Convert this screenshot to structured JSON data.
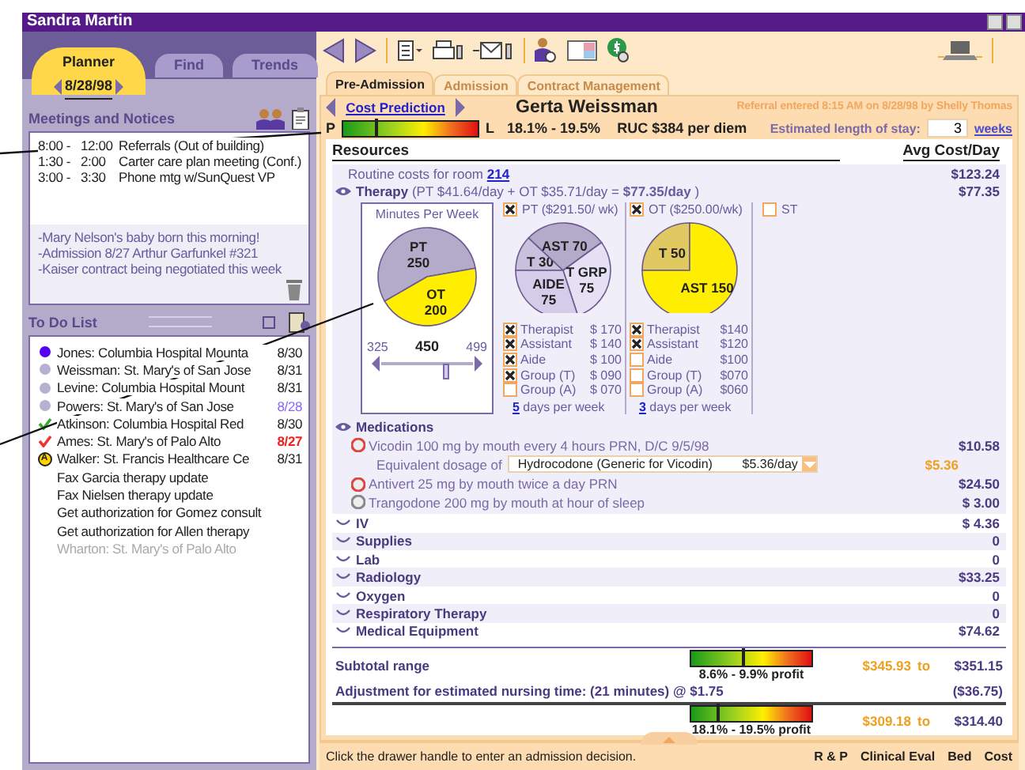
{
  "title_bar": {
    "user": "Sandra Martin"
  },
  "planner": {
    "tabs": [
      {
        "label": "Planner",
        "selected": true
      },
      {
        "label": "Find",
        "selected": false
      },
      {
        "label": "Trends",
        "selected": false
      }
    ],
    "date": "8/28/98"
  },
  "meetings": {
    "title": "Meetings and Notices",
    "events": [
      {
        "start": "8:00 -",
        "end": "12:00",
        "text": "Referrals (Out of building)"
      },
      {
        "start": "1:30 -",
        "end": "2:00",
        "text": "Carter care plan meeting (Conf.)"
      },
      {
        "start": "3:00 -",
        "end": "3:30",
        "text": "Phone mtg w/SunQuest VP"
      }
    ],
    "notices": [
      "-Mary Nelson's baby born this morning!",
      "-Admission 8/27 Arthur Garfunkel #321",
      "-Kaiser contract being negotiated this week"
    ]
  },
  "todo": {
    "title": "To Do List",
    "items": [
      {
        "kind": "dot",
        "color": "#5500ee",
        "text": "Jones: Columbia Hospital Mounta",
        "date": "8/30",
        "due_today": false,
        "overdue": false,
        "disabled": false
      },
      {
        "kind": "dot",
        "color": "#b8b0d0",
        "text": "Weissman: St. Mary's of San Jose",
        "date": "8/31",
        "due_today": false,
        "overdue": false,
        "disabled": false
      },
      {
        "kind": "dot",
        "color": "#b8b0d0",
        "text": "Levine: Columbia Hospital Mount",
        "date": "8/31",
        "due_today": false,
        "overdue": false,
        "disabled": false
      },
      {
        "kind": "dot",
        "color": "#b8b0d0",
        "text": "Powers: St. Mary's of San Jose",
        "date": "8/28",
        "due_today": true,
        "overdue": false,
        "disabled": false
      },
      {
        "kind": "check",
        "color": "#33aa33",
        "text": "Atkinson: Columbia Hospital Red",
        "date": "8/30",
        "due_today": false,
        "overdue": false,
        "disabled": false
      },
      {
        "kind": "check",
        "color": "#ee3333",
        "text": "Ames: St. Mary's of Palo Alto",
        "date": "8/27",
        "due_today": false,
        "overdue": true,
        "disabled": false
      },
      {
        "kind": "badge",
        "badge": "A",
        "text": "Walker: St. Francis Healthcare Ce",
        "date": "8/31",
        "due_today": false,
        "overdue": false,
        "disabled": false
      },
      {
        "kind": "plain",
        "text": "Fax Garcia therapy update",
        "disabled": false
      },
      {
        "kind": "plain",
        "text": "Fax Nielsen therapy update",
        "disabled": false
      },
      {
        "kind": "plain",
        "text": "Get authorization for Gomez consult",
        "disabled": false
      },
      {
        "kind": "plain",
        "text": "Get authorization for Allen therapy",
        "disabled": false
      },
      {
        "kind": "plain",
        "text": "Wharton: St. Mary's of Palo Alto",
        "disabled": true
      }
    ]
  },
  "tabs": [
    {
      "label": "Pre-Admission",
      "selected": true
    },
    {
      "label": "Admission",
      "selected": false
    },
    {
      "label": "Contract Management",
      "selected": false
    }
  ],
  "header": {
    "section": "Cost Prediction",
    "patient": "Gerta Weissman",
    "referral": "Referral entered 8:15 AM on 8/28/98 by Shelly Thomas"
  },
  "profit_meter": {
    "left_label": "P",
    "right_label": "L",
    "level": 0.25,
    "range": "18.1% - 19.5%",
    "ruc": "RUC $384 per diem",
    "stay_label": "Estimated length of stay:",
    "stay_value": "3",
    "stay_unit": "weeks"
  },
  "resources": {
    "title": "Resources",
    "cost_title": "Avg Cost/Day",
    "routine": {
      "text": "Routine costs for room ",
      "room": "214",
      "amount": "$123.24"
    },
    "therapy": {
      "name": "Therapy",
      "expanded": true,
      "detail": "(PT $41.64/day + OT $35.71/day = **$77.35/day** )",
      "amount": "$77.35",
      "minutes": {
        "title": "Minutes Per Week",
        "slices": [
          {
            "label": "PT",
            "value": "250",
            "color": "#b4abcb",
            "two_line": true
          },
          {
            "label": "OT",
            "value": "200",
            "color": "#ffee00",
            "two_line": true
          }
        ],
        "min": "325",
        "max": "499",
        "value": "450",
        "level": 0.72
      },
      "disciplines": [
        {
          "kind": "pie",
          "label": "PT",
          "rate": "($291.50/ wk)",
          "checked": true,
          "slices": [
            {
              "label": "T",
              "value": "30",
              "color": "#c8c0dc",
              "two_line": false
            },
            {
              "label": "AST",
              "value": "70",
              "color": "#b4abcb",
              "two_line": false
            },
            {
              "label": "T GRP",
              "value": "75",
              "color": "#e6e0f4",
              "two_line": true
            },
            {
              "label": "AIDE",
              "value": "75",
              "color": "#d4cce8",
              "two_line": true
            }
          ],
          "options": [
            {
              "label": "Therapist",
              "price": "$  170",
              "checked": true
            },
            {
              "label": "Assistant",
              "price": "$  140",
              "checked": true
            },
            {
              "label": "Aide",
              "price": "$  100",
              "checked": true
            },
            {
              "label": "Group (T)",
              "price": "$  090",
              "checked": true
            },
            {
              "label": "Group (A)",
              "price": "$  070",
              "checked": false
            }
          ],
          "days": "5",
          "days_text": " days per week"
        },
        {
          "kind": "pie",
          "label": "OT",
          "rate": "($250.00/wk)",
          "checked": true,
          "slices": [
            {
              "label": "T",
              "value": "50",
              "color": "#e2c860",
              "two_line": false
            },
            {
              "label": "AST",
              "value": "150",
              "color": "#ffee00",
              "two_line": false
            }
          ],
          "options": [
            {
              "label": "Therapist",
              "price": "$140",
              "checked": true
            },
            {
              "label": "Assistant",
              "price": "$120",
              "checked": true
            },
            {
              "label": "Aide",
              "price": "$100",
              "checked": false
            },
            {
              "label": "Group (T)",
              "price": "$070",
              "checked": false
            },
            {
              "label": "Group (A)",
              "price": "$060",
              "checked": false
            }
          ],
          "days": "3",
          "days_text": " days per week"
        },
        {
          "kind": "empty",
          "label": "ST",
          "checked": false
        }
      ]
    },
    "medications": {
      "name": "Medications",
      "expanded": true,
      "items": [
        {
          "color": "#dd4444",
          "text": "Vicodin  100 mg by mouth every 4 hours PRN, D/C 9/5/98",
          "amount": "$10.58",
          "equivalent": {
            "label": "Equivalent dosage of",
            "value": "Hydrocodone (Generic for Vicodin)",
            "price": "$5.36/day",
            "amount": "$5.36"
          }
        },
        {
          "color": "#dd4444",
          "text": "Antivert 25 mg by mouth twice a day PRN",
          "amount": "$24.50"
        },
        {
          "color": "#888888",
          "text": "Trangodone 200 mg by mouth at hour of sleep",
          "amount": "$ 3.00"
        }
      ]
    },
    "categories": [
      {
        "name": "IV",
        "amount": "$ 4.36",
        "expanded": false
      },
      {
        "name": "Supplies",
        "amount": "0",
        "expanded": false
      },
      {
        "name": "Lab",
        "amount": "0",
        "expanded": false
      },
      {
        "name": "Radiology",
        "amount": "$33.25",
        "expanded": false
      },
      {
        "name": "Oxygen",
        "amount": "0",
        "expanded": false
      },
      {
        "name": "Respiratory Therapy",
        "amount": "0",
        "expanded": false
      },
      {
        "name": "Medical Equipment",
        "amount": "$74.62",
        "expanded": false
      }
    ],
    "subtotal": {
      "label": "Subtotal range",
      "level": 0.43,
      "profit": "8.6% - 9.9% profit",
      "low": "$345.93",
      "to": "to",
      "high": "$351.15"
    },
    "adjustment": {
      "label": "Adjustment for estimated nursing time: (21 minutes) @ $1.75",
      "amount": "($36.75)"
    },
    "total": {
      "level": 0.23,
      "profit": "18.1% - 19.5% profit",
      "low": "$309.18",
      "to": "to",
      "high": "$314.40"
    }
  },
  "status_bar": {
    "message": "Click the drawer handle to enter an admission decision.",
    "links": [
      "R & P",
      "Clinical Eval",
      "Bed",
      "Cost"
    ]
  }
}
